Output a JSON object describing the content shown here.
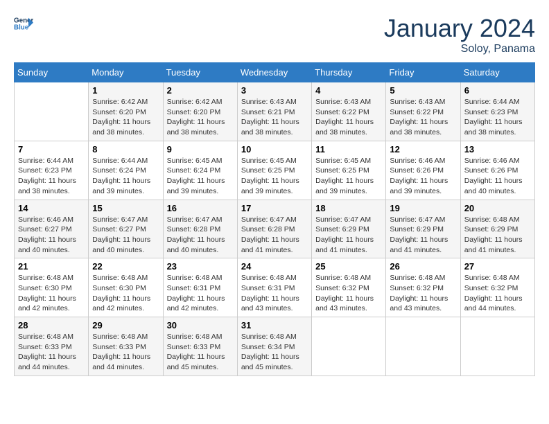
{
  "header": {
    "logo_line1": "General",
    "logo_line2": "Blue",
    "month": "January 2024",
    "location": "Soloy, Panama"
  },
  "days_of_week": [
    "Sunday",
    "Monday",
    "Tuesday",
    "Wednesday",
    "Thursday",
    "Friday",
    "Saturday"
  ],
  "weeks": [
    [
      {
        "day": "",
        "info": ""
      },
      {
        "day": "1",
        "info": "Sunrise: 6:42 AM\nSunset: 6:20 PM\nDaylight: 11 hours\nand 38 minutes."
      },
      {
        "day": "2",
        "info": "Sunrise: 6:42 AM\nSunset: 6:20 PM\nDaylight: 11 hours\nand 38 minutes."
      },
      {
        "day": "3",
        "info": "Sunrise: 6:43 AM\nSunset: 6:21 PM\nDaylight: 11 hours\nand 38 minutes."
      },
      {
        "day": "4",
        "info": "Sunrise: 6:43 AM\nSunset: 6:22 PM\nDaylight: 11 hours\nand 38 minutes."
      },
      {
        "day": "5",
        "info": "Sunrise: 6:43 AM\nSunset: 6:22 PM\nDaylight: 11 hours\nand 38 minutes."
      },
      {
        "day": "6",
        "info": "Sunrise: 6:44 AM\nSunset: 6:23 PM\nDaylight: 11 hours\nand 38 minutes."
      }
    ],
    [
      {
        "day": "7",
        "info": "Sunrise: 6:44 AM\nSunset: 6:23 PM\nDaylight: 11 hours\nand 38 minutes."
      },
      {
        "day": "8",
        "info": "Sunrise: 6:44 AM\nSunset: 6:24 PM\nDaylight: 11 hours\nand 39 minutes."
      },
      {
        "day": "9",
        "info": "Sunrise: 6:45 AM\nSunset: 6:24 PM\nDaylight: 11 hours\nand 39 minutes."
      },
      {
        "day": "10",
        "info": "Sunrise: 6:45 AM\nSunset: 6:25 PM\nDaylight: 11 hours\nand 39 minutes."
      },
      {
        "day": "11",
        "info": "Sunrise: 6:45 AM\nSunset: 6:25 PM\nDaylight: 11 hours\nand 39 minutes."
      },
      {
        "day": "12",
        "info": "Sunrise: 6:46 AM\nSunset: 6:26 PM\nDaylight: 11 hours\nand 39 minutes."
      },
      {
        "day": "13",
        "info": "Sunrise: 6:46 AM\nSunset: 6:26 PM\nDaylight: 11 hours\nand 40 minutes."
      }
    ],
    [
      {
        "day": "14",
        "info": "Sunrise: 6:46 AM\nSunset: 6:27 PM\nDaylight: 11 hours\nand 40 minutes."
      },
      {
        "day": "15",
        "info": "Sunrise: 6:47 AM\nSunset: 6:27 PM\nDaylight: 11 hours\nand 40 minutes."
      },
      {
        "day": "16",
        "info": "Sunrise: 6:47 AM\nSunset: 6:28 PM\nDaylight: 11 hours\nand 40 minutes."
      },
      {
        "day": "17",
        "info": "Sunrise: 6:47 AM\nSunset: 6:28 PM\nDaylight: 11 hours\nand 41 minutes."
      },
      {
        "day": "18",
        "info": "Sunrise: 6:47 AM\nSunset: 6:29 PM\nDaylight: 11 hours\nand 41 minutes."
      },
      {
        "day": "19",
        "info": "Sunrise: 6:47 AM\nSunset: 6:29 PM\nDaylight: 11 hours\nand 41 minutes."
      },
      {
        "day": "20",
        "info": "Sunrise: 6:48 AM\nSunset: 6:29 PM\nDaylight: 11 hours\nand 41 minutes."
      }
    ],
    [
      {
        "day": "21",
        "info": "Sunrise: 6:48 AM\nSunset: 6:30 PM\nDaylight: 11 hours\nand 42 minutes."
      },
      {
        "day": "22",
        "info": "Sunrise: 6:48 AM\nSunset: 6:30 PM\nDaylight: 11 hours\nand 42 minutes."
      },
      {
        "day": "23",
        "info": "Sunrise: 6:48 AM\nSunset: 6:31 PM\nDaylight: 11 hours\nand 42 minutes."
      },
      {
        "day": "24",
        "info": "Sunrise: 6:48 AM\nSunset: 6:31 PM\nDaylight: 11 hours\nand 43 minutes."
      },
      {
        "day": "25",
        "info": "Sunrise: 6:48 AM\nSunset: 6:32 PM\nDaylight: 11 hours\nand 43 minutes."
      },
      {
        "day": "26",
        "info": "Sunrise: 6:48 AM\nSunset: 6:32 PM\nDaylight: 11 hours\nand 43 minutes."
      },
      {
        "day": "27",
        "info": "Sunrise: 6:48 AM\nSunset: 6:32 PM\nDaylight: 11 hours\nand 44 minutes."
      }
    ],
    [
      {
        "day": "28",
        "info": "Sunrise: 6:48 AM\nSunset: 6:33 PM\nDaylight: 11 hours\nand 44 minutes."
      },
      {
        "day": "29",
        "info": "Sunrise: 6:48 AM\nSunset: 6:33 PM\nDaylight: 11 hours\nand 44 minutes."
      },
      {
        "day": "30",
        "info": "Sunrise: 6:48 AM\nSunset: 6:33 PM\nDaylight: 11 hours\nand 45 minutes."
      },
      {
        "day": "31",
        "info": "Sunrise: 6:48 AM\nSunset: 6:34 PM\nDaylight: 11 hours\nand 45 minutes."
      },
      {
        "day": "",
        "info": ""
      },
      {
        "day": "",
        "info": ""
      },
      {
        "day": "",
        "info": ""
      }
    ]
  ]
}
